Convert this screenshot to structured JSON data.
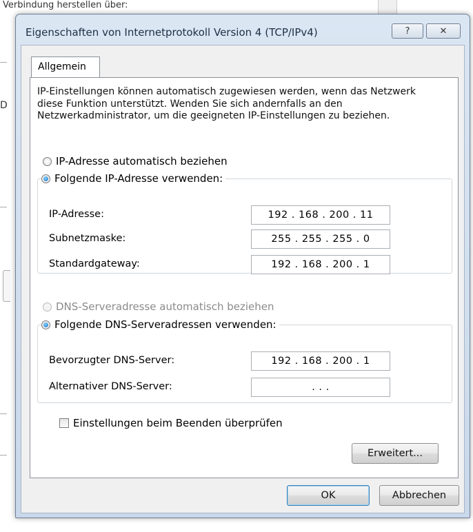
{
  "background": {
    "partial_title": "Verbindung herstellen über:"
  },
  "dialog": {
    "title": "Eigenschaften von Internetprotokoll Version 4 (TCP/IPv4)",
    "help_label": "?",
    "close_label": "✕",
    "tab_label": "Allgemein",
    "description": "IP-Einstellungen können automatisch zugewiesen werden, wenn das Netzwerk diese Funktion unterstützt. Wenden Sie sich andernfalls an den Netzwerkadministrator, um die geeigneten IP-Einstellungen zu beziehen.",
    "ip_auto_label": "IP-Adresse automatisch beziehen",
    "ip_manual_label": "Folgende IP-Adresse verwenden:",
    "ip_mode_selected": "manual",
    "ip_address_label": "IP-Adresse:",
    "ip_address_value": "192 . 168 . 200 .  11",
    "subnet_label": "Subnetzmaske:",
    "subnet_value": "255 . 255 . 255 .  0",
    "gateway_label": "Standardgateway:",
    "gateway_value": "192 . 168 . 200 .  1",
    "dns_auto_label": "DNS-Serveradresse automatisch beziehen",
    "dns_manual_label": "Folgende DNS-Serveradressen verwenden:",
    "dns_mode_selected": "manual",
    "dns_preferred_label": "Bevorzugter DNS-Server:",
    "dns_preferred_value": "192 . 168 . 200 .  1",
    "dns_alternate_label": "Alternativer DNS-Server:",
    "dns_alternate_value": ".       .       .",
    "validate_label": "Einstellungen beim Beenden überprüfen",
    "validate_checked": false,
    "advanced_label": "Erweitert...",
    "ok_label": "OK",
    "cancel_label": "Abbrechen"
  },
  "colors": {
    "frame": "#c9d8ea",
    "radio_selected": "#1a6fc4",
    "disabled_text": "#8a8a8a"
  }
}
